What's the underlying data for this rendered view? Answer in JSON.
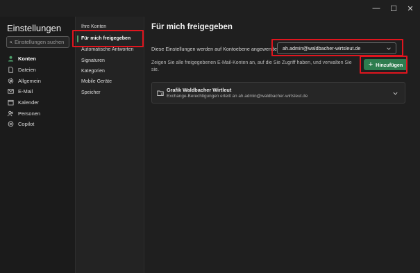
{
  "window": {
    "controls": {
      "minimize": "—",
      "maximize": "☐",
      "close": "✕"
    }
  },
  "leftnav": {
    "title": "Einstellungen",
    "search_placeholder": "Einstellungen suchen",
    "items": [
      {
        "label": "Konten",
        "icon": "person-icon",
        "active": true
      },
      {
        "label": "Dateien",
        "icon": "file-icon",
        "active": false
      },
      {
        "label": "Allgemein",
        "icon": "gear-icon",
        "active": false
      },
      {
        "label": "E-Mail",
        "icon": "mail-icon",
        "active": false
      },
      {
        "label": "Kalender",
        "icon": "calendar-icon",
        "active": false
      },
      {
        "label": "Personen",
        "icon": "people-icon",
        "active": false
      },
      {
        "label": "Copilot",
        "icon": "copilot-icon",
        "active": false
      }
    ]
  },
  "subnav": {
    "items": [
      {
        "label": "Ihre Konten",
        "active": false
      },
      {
        "label": "Für mich freigegeben",
        "active": true
      },
      {
        "label": "Automatische Antworten",
        "active": false
      },
      {
        "label": "Signaturen",
        "active": false
      },
      {
        "label": "Kategorien",
        "active": false
      },
      {
        "label": "Mobile Geräte",
        "active": false
      },
      {
        "label": "Speicher",
        "active": false
      }
    ]
  },
  "main": {
    "title": "Für mich freigegeben",
    "apply_label": "Diese Einstellungen werden auf Kontoebene angewendet.",
    "account_value": "ah.admin@waldbacher-wirtsleut.de",
    "description": "Zeigen Sie alle freigegebenen E-Mail-Konten an, auf die Sie Zugriff haben, und verwalten Sie sie.",
    "add_button": "Hinzufügen",
    "shared_accounts": [
      {
        "name": "Grafik Waldbacher Wirtleut",
        "detail": "Exchange-Berechtigungen erteilt an ah.admin@waldbacher-wirtsleut.de"
      }
    ]
  },
  "colors": {
    "accent_green": "#2e7d4f",
    "highlight_red": "#e0151e",
    "background": "#1f1f1f"
  }
}
